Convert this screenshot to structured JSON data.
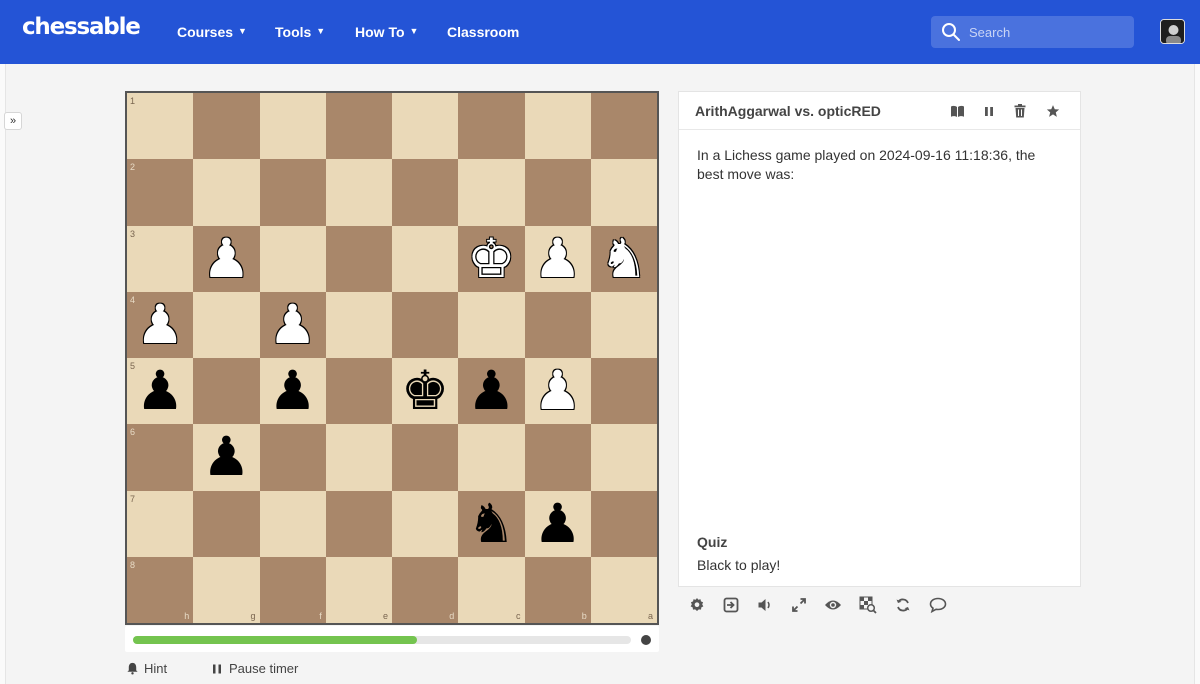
{
  "brand": "chessable",
  "nav": [
    {
      "label": "Courses",
      "has_menu": true
    },
    {
      "label": "Tools",
      "has_menu": true
    },
    {
      "label": "How To",
      "has_menu": true
    },
    {
      "label": "Classroom",
      "has_menu": false
    }
  ],
  "search": {
    "placeholder": "Search"
  },
  "colors": {
    "topbar": "#2454d6",
    "light_square": "#ead9b8",
    "dark_square": "#a9876a",
    "progress": "#74c44f"
  },
  "board": {
    "ranks": [
      "1",
      "2",
      "3",
      "4",
      "5",
      "6",
      "7",
      "8"
    ],
    "files": [
      "h",
      "g",
      "f",
      "e",
      "d",
      "c",
      "b",
      "a"
    ],
    "pieces": [
      {
        "row": 2,
        "col": 1,
        "glyph": "♟",
        "color": "white"
      },
      {
        "row": 2,
        "col": 5,
        "glyph": "♚",
        "color": "white"
      },
      {
        "row": 2,
        "col": 6,
        "glyph": "♟",
        "color": "white"
      },
      {
        "row": 2,
        "col": 7,
        "glyph": "♞",
        "color": "white"
      },
      {
        "row": 3,
        "col": 0,
        "glyph": "♟",
        "color": "white"
      },
      {
        "row": 3,
        "col": 2,
        "glyph": "♟",
        "color": "white"
      },
      {
        "row": 4,
        "col": 0,
        "glyph": "♟",
        "color": "black"
      },
      {
        "row": 4,
        "col": 2,
        "glyph": "♟",
        "color": "black"
      },
      {
        "row": 4,
        "col": 4,
        "glyph": "♚",
        "color": "black"
      },
      {
        "row": 4,
        "col": 5,
        "glyph": "♟",
        "color": "black"
      },
      {
        "row": 4,
        "col": 6,
        "glyph": "♟",
        "color": "white"
      },
      {
        "row": 5,
        "col": 1,
        "glyph": "♟",
        "color": "black"
      },
      {
        "row": 6,
        "col": 5,
        "glyph": "♞",
        "color": "black"
      },
      {
        "row": 6,
        "col": 6,
        "glyph": "♟",
        "color": "black"
      }
    ]
  },
  "progress": {
    "fraction": 0.57
  },
  "controls": {
    "hint": "Hint",
    "pause": "Pause timer"
  },
  "panel": {
    "title": "ArithAggarwal vs. opticRED",
    "header_icons": [
      "book-icon",
      "pause-icon",
      "trash-icon",
      "star-icon"
    ],
    "body": "In a Lichess game played on 2024-09-16 11:18:36, the best move was:",
    "quiz_title": "Quiz",
    "quiz_text": "Black to play!"
  },
  "toolbar_icons": [
    "settings-icon",
    "exit-icon",
    "volume-icon",
    "fullscreen-icon",
    "eye-icon",
    "board-search-icon",
    "flip-icon",
    "comment-icon"
  ]
}
